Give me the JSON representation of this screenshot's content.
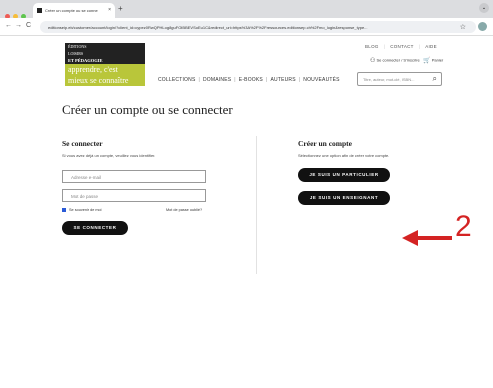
{
  "browser": {
    "tab_title": "Créer un compte ou se conne",
    "tab_close": "×",
    "new_tab": "+",
    "url": "editionseip.eb/customer/account/login/?client_id=cypez0RwQPHLog8guFOIBBEVSoEu1C&redirect_uri=https%3A%2F%2Fressources.editionsep.ch%2Fmo_login&response_type...",
    "nav": {
      "back": "←",
      "forward": "→",
      "reload": "C"
    }
  },
  "header": {
    "logo_line1": "ÉDITIONS",
    "logo_line2": "LOISIRS",
    "logo_line3": "ET PÉDAGOGIE",
    "logo_tagline1": "apprendre, c'est",
    "logo_tagline2": "mieux se connaître",
    "top_links": [
      "BLOG",
      "CONTACT",
      "AIDE"
    ],
    "account_link": "Se connecter / S'inscrire",
    "cart_link": "Panier",
    "nav_items": [
      "COLLECTIONS",
      "DOMAINES",
      "E-BOOKS",
      "AUTEURS",
      "NOUVEAUTÉS"
    ],
    "search_placeholder": "Titre, auteur, mot-clé, ISBN..."
  },
  "main": {
    "title": "Créer un compte ou se connecter",
    "login": {
      "heading": "Se connecter",
      "subtitle": "Si vous avez déjà un compte, veuillez vous identifier.",
      "email_placeholder": "Adresse e-mail",
      "password_placeholder": "Mot de passe",
      "remember_label": "Se souvenir de moi",
      "forgot_link": "Mot de passe oublié?",
      "submit_label": "SE CONNECTER"
    },
    "register": {
      "heading": "Créer un compte",
      "subtitle": "Sélectionnez une option afin de créer votre compte.",
      "individual_label": "JE SUIS UN PARTICULIER",
      "teacher_label": "JE SUIS UN ENSEIGNANT"
    }
  },
  "annotation": {
    "number": "2",
    "color": "#d42323"
  }
}
